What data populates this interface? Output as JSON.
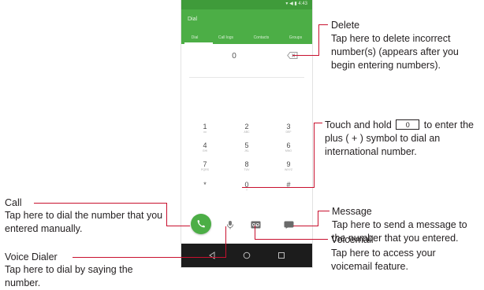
{
  "phone": {
    "status_text": "▾ ◀ ▮ 4:43",
    "app_title": "Dial",
    "tabs": [
      "Dial",
      "Call logs",
      "Contacts",
      "Groups"
    ],
    "entered_digit": "0",
    "keypad": [
      {
        "digit": "1",
        "sub": "oo"
      },
      {
        "digit": "2",
        "sub": "ABC"
      },
      {
        "digit": "3",
        "sub": "DEF"
      },
      {
        "digit": "4",
        "sub": "GHI"
      },
      {
        "digit": "5",
        "sub": "JKL"
      },
      {
        "digit": "6",
        "sub": "MNO"
      },
      {
        "digit": "7",
        "sub": "PQRS"
      },
      {
        "digit": "8",
        "sub": "TUV"
      },
      {
        "digit": "9",
        "sub": "WXYZ"
      },
      {
        "digit": "*",
        "sub": ""
      },
      {
        "digit": "0",
        "sub": "+"
      },
      {
        "digit": "#",
        "sub": ""
      }
    ],
    "accent_color": "#4cae46"
  },
  "annotations": {
    "delete": {
      "title": "Delete",
      "desc": "Tap here to delete incorrect number(s) (appears after you begin entering numbers)."
    },
    "touch_hold": {
      "pre": "Touch and hold",
      "key": "0",
      "post": "to enter the plus ( + ) symbol to dial an international number."
    },
    "message": {
      "title": "Message",
      "desc": "Tap here to send a message to the number that you entered."
    },
    "voicemail": {
      "title": "Voicemail",
      "desc": "Tap here to access your voicemail feature."
    },
    "call": {
      "title": "Call",
      "desc": "Tap here to dial the number that you entered manually."
    },
    "voice_dialer": {
      "title": "Voice Dialer",
      "desc": "Tap here to dial by saying the number."
    }
  },
  "colors": {
    "callout_line": "#c8102e",
    "text": "#231f20"
  }
}
